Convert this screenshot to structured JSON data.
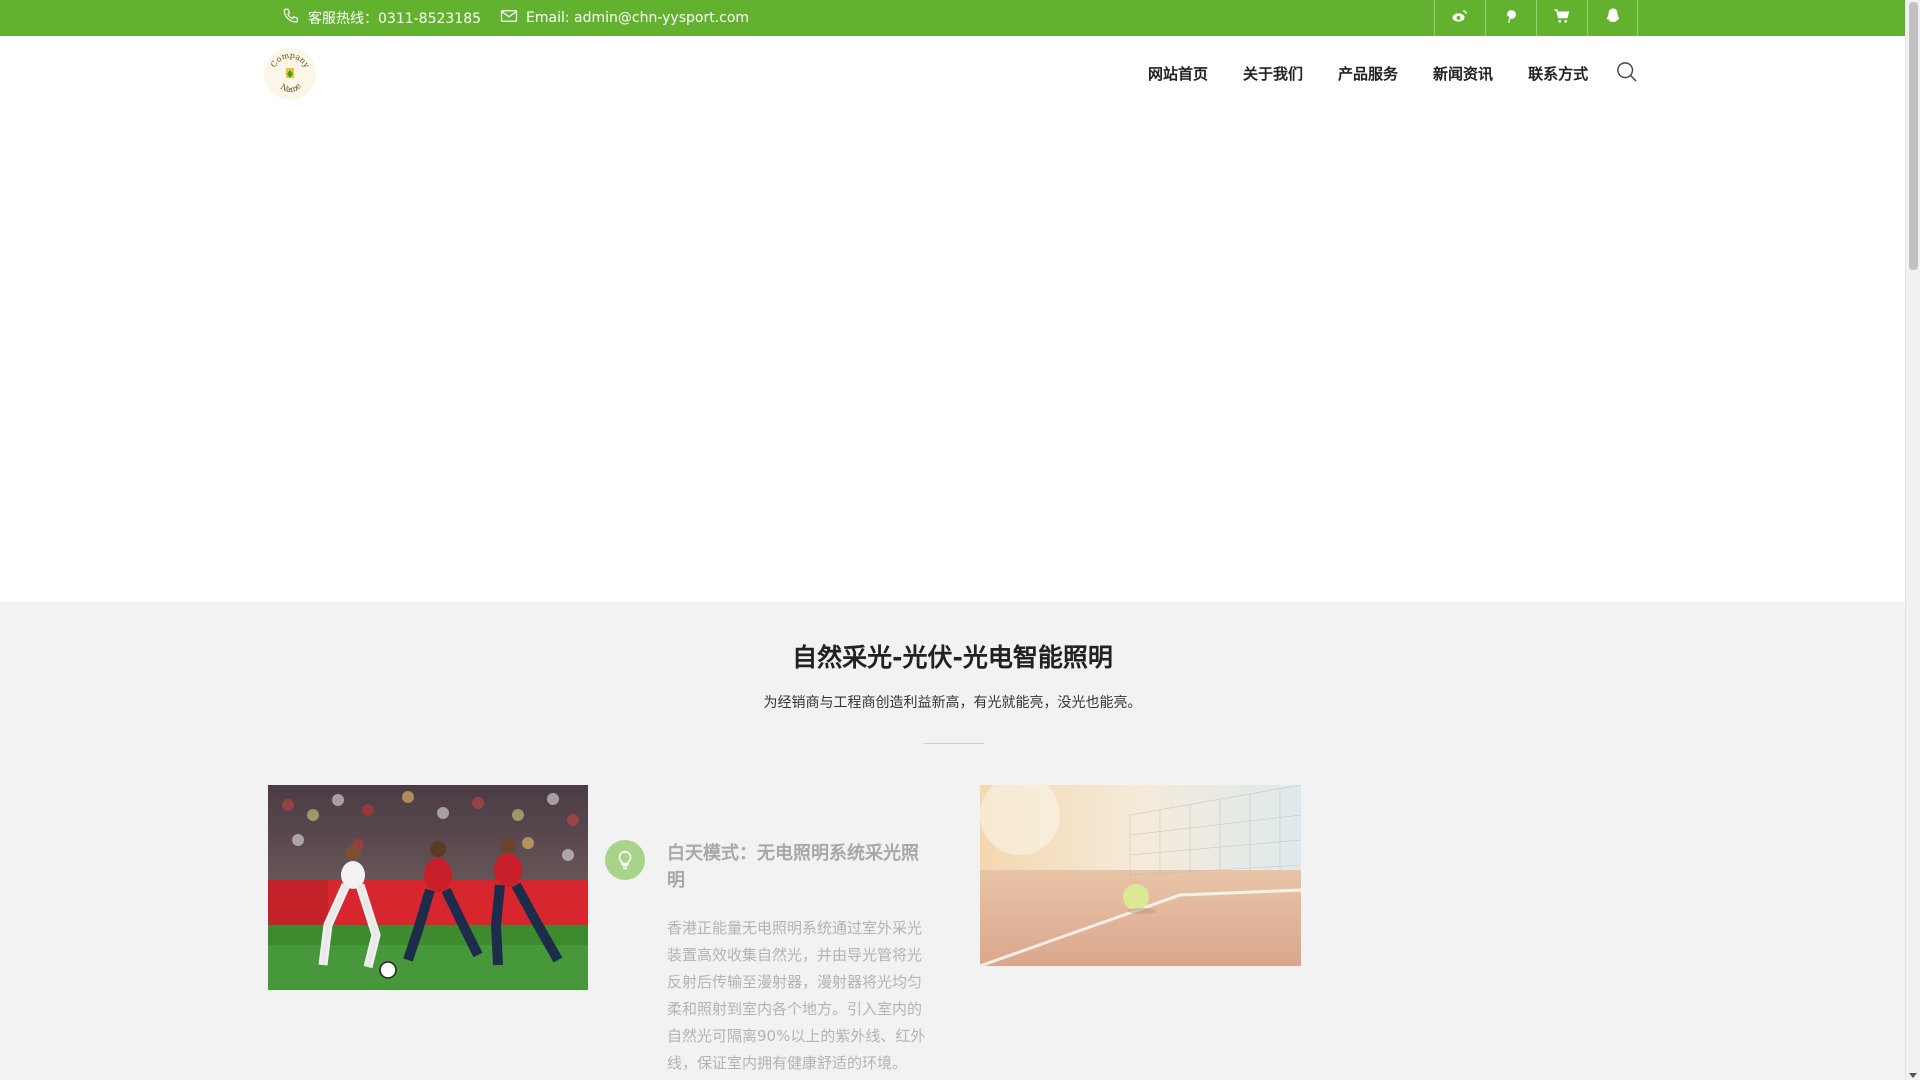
{
  "topbar": {
    "hotline": "客服热线：0311-8523185",
    "email": "Email: admin@chn-yysport.com",
    "social_icons": [
      "weibo-icon",
      "pinterest-icon",
      "cart-icon",
      "qq-icon"
    ],
    "background": "#62b230"
  },
  "header": {
    "logo_text_top": "Company",
    "logo_text_bottom": "Name",
    "nav": [
      "网站首页",
      "关于我们",
      "产品服务",
      "新闻资讯",
      "联系方式"
    ],
    "search_icon": "search-icon"
  },
  "section": {
    "title": "自然采光-光伏-光电智能照明",
    "subtitle": "为经销商与工程商创造利益新高，有光就能亮，没光也能亮。",
    "feature": {
      "icon": "lightbulb-icon",
      "title": "白天模式：无电照明系统采光照明",
      "text": "香港正能量无电照明系统通过室外采光装置高效收集自然光，并由导光管将光反射后传输至漫射器，漫射器将光均匀柔和照射到室内各个地方。引入室内的自然光可隔离90%以上的紫外线、红外线，保证室内拥有健康舒适的环境。"
    }
  }
}
